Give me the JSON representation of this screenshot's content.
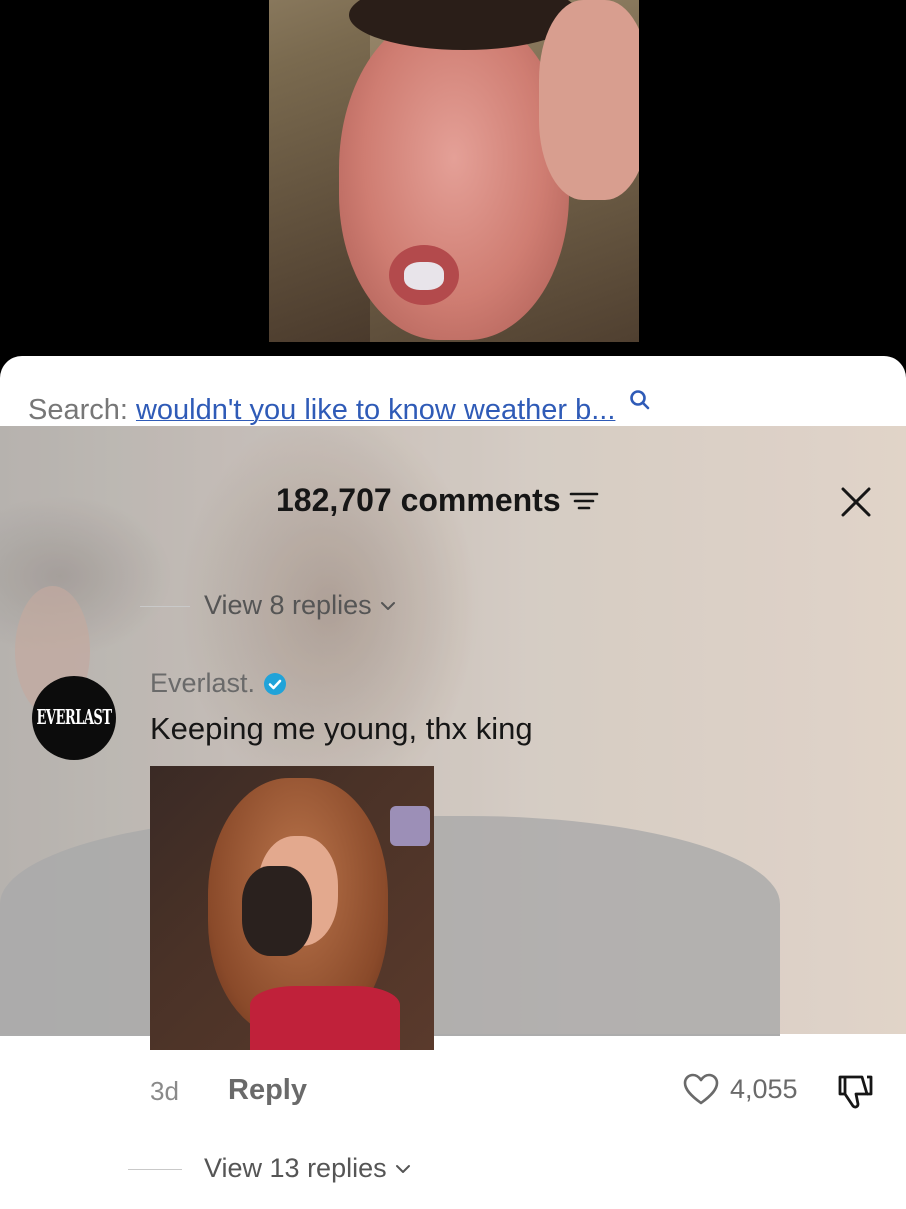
{
  "search": {
    "label": "Search:",
    "query": "wouldn't you like to know weather b..."
  },
  "comments": {
    "count_label": "182,707 comments"
  },
  "thread": {
    "view_replies_top": "View 8 replies",
    "view_replies_bottom": "View 13 replies"
  },
  "comment": {
    "username": "Everlast.",
    "avatar_text": "EVERLAST",
    "text": "Keeping me young, thx king",
    "time": "3d",
    "reply_label": "Reply",
    "likes": "4,055"
  },
  "icons": {
    "search": "search-icon",
    "filter": "filter-icon",
    "close": "close-icon",
    "verified": "verified-badge-icon",
    "heart": "heart-icon",
    "dislike": "dislike-icon",
    "chevron": "chevron-down-icon"
  },
  "colors": {
    "link_blue": "#2f5bb7",
    "verified_teal": "#20a3d9",
    "sheet_bg": "#ffffff"
  }
}
